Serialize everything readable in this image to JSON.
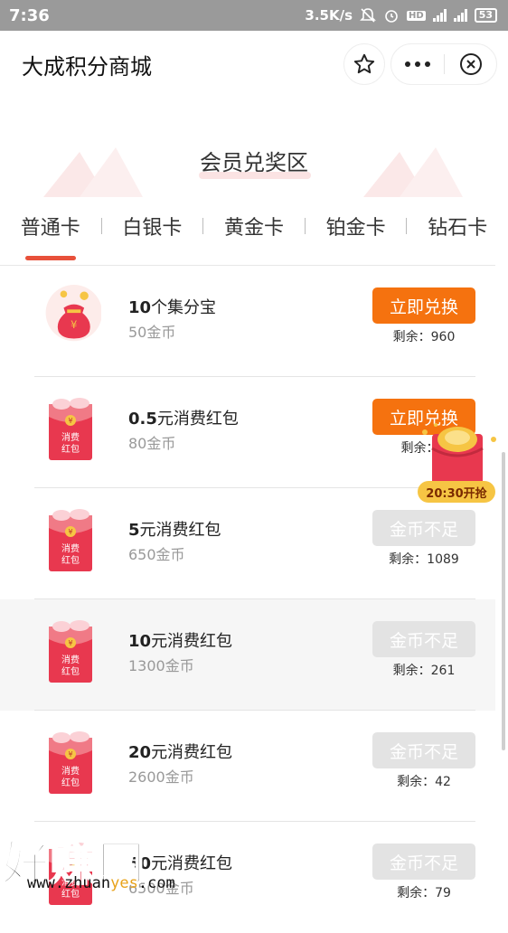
{
  "status_bar": {
    "time": "7:36",
    "speed": "3.5K/s",
    "net": "4G",
    "battery": "53"
  },
  "header": {
    "title": "大成积分商城"
  },
  "section": {
    "title": "会员兑奖区",
    "tabs": [
      {
        "label": "普通卡",
        "active": true
      },
      {
        "label": "白银卡",
        "active": false
      },
      {
        "label": "黄金卡",
        "active": false
      },
      {
        "label": "铂金卡",
        "active": false
      },
      {
        "label": "钻石卡",
        "active": false
      }
    ]
  },
  "items": [
    {
      "num": "10",
      "name": "个集分宝",
      "cost": "50金币",
      "button": "立即兑换",
      "status": "available",
      "remain": "剩余：960",
      "icon": "money-bag-icon"
    },
    {
      "num": "0.5",
      "name": "元消费红包",
      "cost": "80金币",
      "button": "立即兑换",
      "status": "available",
      "remain": "剩余：1",
      "icon": "red-envelope-icon",
      "envelope_text": [
        "消费",
        "红包"
      ]
    },
    {
      "num": "5",
      "name": "元消费红包",
      "cost": "650金币",
      "button": "金币不足",
      "status": "insufficient",
      "remain": "剩余：1089",
      "icon": "red-envelope-icon",
      "envelope_text": [
        "消费",
        "红包"
      ]
    },
    {
      "num": "10",
      "name": "元消费红包",
      "cost": "1300金币",
      "button": "金币不足",
      "status": "insufficient",
      "remain": "剩余：261",
      "icon": "red-envelope-icon",
      "envelope_text": [
        "消费",
        "红包"
      ]
    },
    {
      "num": "20",
      "name": "元消费红包",
      "cost": "2600金币",
      "button": "金币不足",
      "status": "insufficient",
      "remain": "剩余：42",
      "icon": "red-envelope-icon",
      "envelope_text": [
        "消费",
        "红包"
      ]
    },
    {
      "num": "50",
      "name": "元消费红包",
      "cost": "6500金币",
      "button": "金币不足",
      "status": "insufficient",
      "remain": "剩余：79",
      "icon": "red-envelope-icon",
      "envelope_text": [
        "消费",
        "红包"
      ]
    }
  ],
  "float_packet": {
    "label": "20:30开抢"
  },
  "watermark": {
    "big": "好赚网",
    "small_prefix": "www.zhuan",
    "small_accent": "yes",
    "small_suffix": ".com"
  },
  "colors": {
    "accent_orange": "#f5720f",
    "tab_underline": "#e8503a",
    "disabled_button": "#e3e3e3",
    "envelope_red": "#e8384f"
  }
}
